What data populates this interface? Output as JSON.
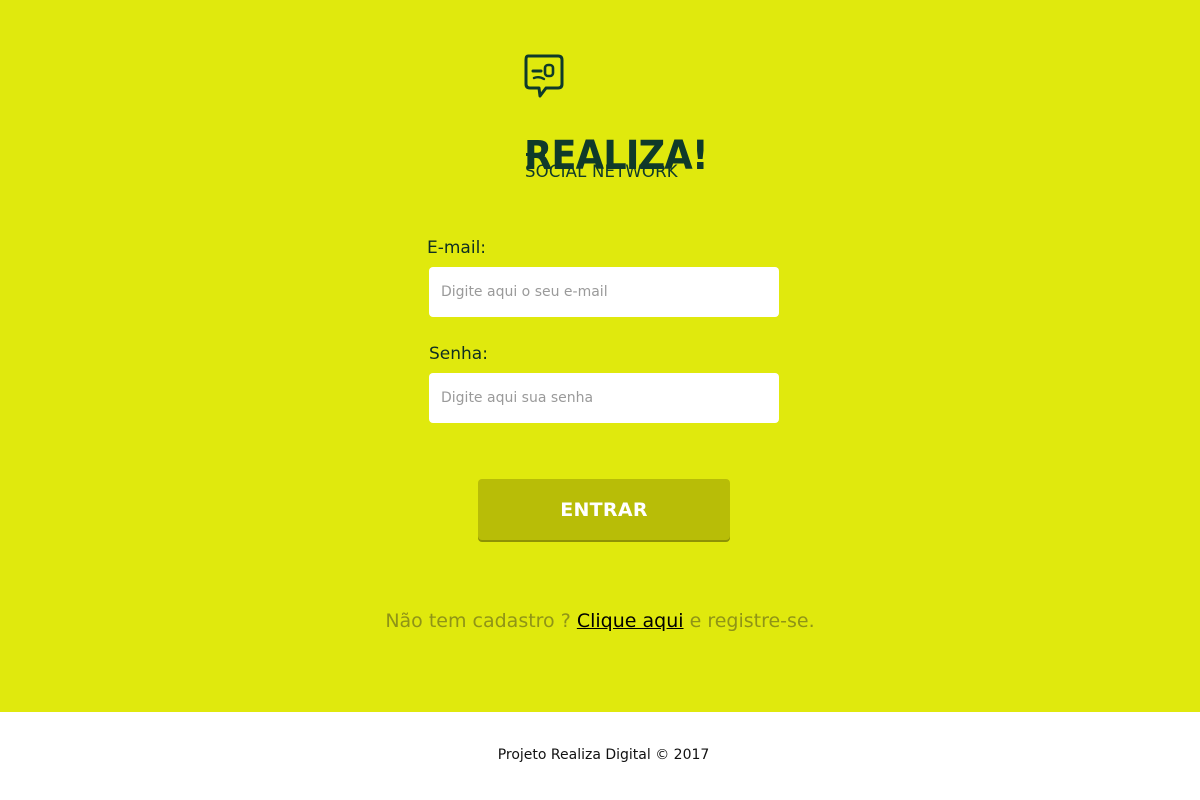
{
  "brand": {
    "name": "REALIZA!",
    "subtitle": "SOCIAL NETWORK",
    "color": "#0f3a2a",
    "icon": "speech-bubble-face-icon"
  },
  "form": {
    "email_label": "E-mail:",
    "email_placeholder": "Digite aqui o seu e-mail",
    "email_value": "",
    "password_label": "Senha:",
    "password_placeholder": "Digite aqui sua senha",
    "password_value": "",
    "submit_label": "ENTRAR"
  },
  "signup": {
    "prefix": "Não tem cadastro ?",
    "link_text": "Clique aqui",
    "suffix": "e registre-se."
  },
  "footer": {
    "text": "Projeto Realiza Digital © 2017"
  },
  "colors": {
    "background": "#e0e90d",
    "button": "#b8bd07",
    "footer_background": "#ffffff",
    "muted_text": "#8f9416"
  }
}
